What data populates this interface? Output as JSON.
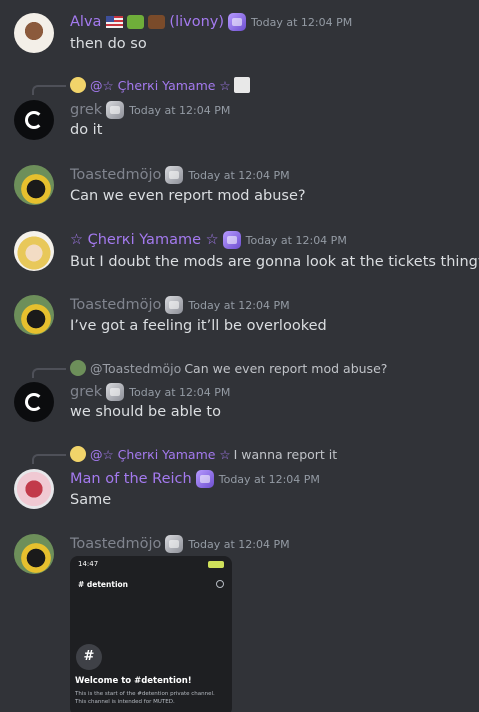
{
  "messages": [
    {
      "author": "Alva",
      "author_suffix": "(livony)",
      "time": "Today at 12:04 PM",
      "text": "then do so"
    },
    {
      "reply_name": "@☆ Çherкi Yamame ☆",
      "reply_text": "",
      "author": "grek",
      "time": "Today at 12:04 PM",
      "text": "do it"
    },
    {
      "author": "Toastedmöjo",
      "time": "Today at 12:04 PM",
      "text": "Can we even report mod abuse?"
    },
    {
      "author": "☆ Çherкi Yamame ☆",
      "time": "Today at 12:04 PM",
      "text": "But I doubt the mods are gonna look at the tickets thingy"
    },
    {
      "author": "Toastedmöjo",
      "time": "Today at 12:04 PM",
      "text": "I’ve got a feeling it’ll be overlooked"
    },
    {
      "reply_name": "@Toastedmöjo",
      "reply_text": "Can we even report mod abuse?",
      "author": "grek",
      "time": "Today at 12:04 PM",
      "text": "we should be able to"
    },
    {
      "reply_name": "@☆ Çherкi Yamame ☆",
      "reply_text": "I wanna report it",
      "author": "Man of the Reich",
      "time": "Today at 12:04 PM",
      "text": "Same"
    },
    {
      "author": "Toastedmöjo",
      "time": "Today at 12:04 PM",
      "text": ""
    }
  ],
  "attachment": {
    "status_time": "14:47",
    "channel": "# detention",
    "hash_glyph": "#",
    "welcome": "Welcome to #detention!",
    "description": "This is the start of the #detention private channel. This channel is intended for MUTED."
  },
  "colors": {
    "background": "#313338",
    "name_purple": "#a47aef",
    "name_gray": "#80848e",
    "text": "#dbdee1",
    "timestamp": "#949ba4"
  },
  "icons": [
    "role-badge-icon",
    "reply-spine-icon",
    "flag-icon",
    "search-icon"
  ]
}
